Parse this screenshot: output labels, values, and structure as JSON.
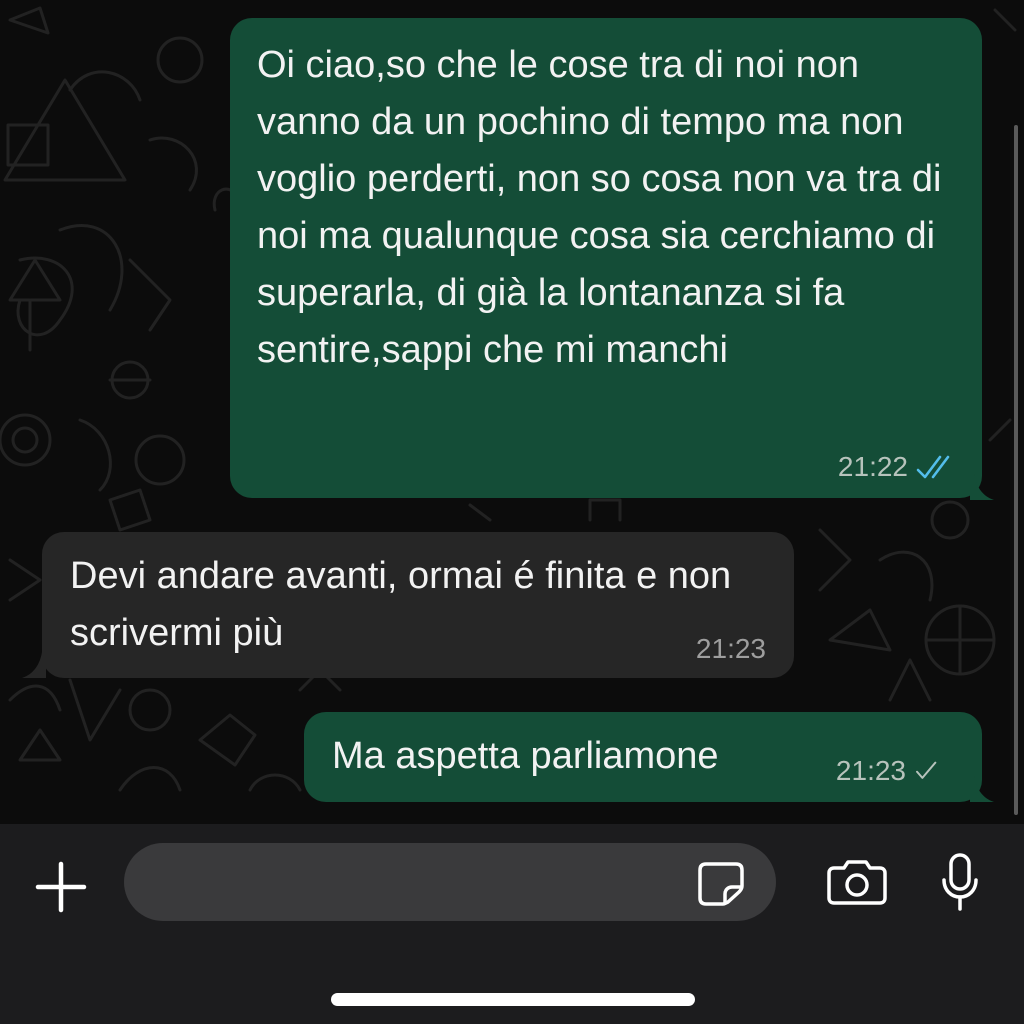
{
  "messages": [
    {
      "direction": "outgoing",
      "text": "Oi ciao,so che le cose tra di noi non vanno da un pochino di tempo ma non voglio perderti, non so cosa non va tra di noi ma qualunque cosa sia cerchiamo di superarla, di già la lontananza si fa sentire,sappi che mi manchi",
      "time": "21:22",
      "status": "read"
    },
    {
      "direction": "incoming",
      "text": "Devi andare avanti, ormai é finita e non scrivermi più",
      "time": "21:23"
    },
    {
      "direction": "outgoing",
      "text": "Ma aspetta parliamone",
      "time": "21:23",
      "status": "sent"
    }
  ],
  "composer": {
    "value": "",
    "placeholder": ""
  },
  "colors": {
    "outgoing_bubble": "#144d37",
    "incoming_bubble": "#262626",
    "read_ticks": "#53bdeb",
    "sent_tick": "#b7c3bc"
  }
}
